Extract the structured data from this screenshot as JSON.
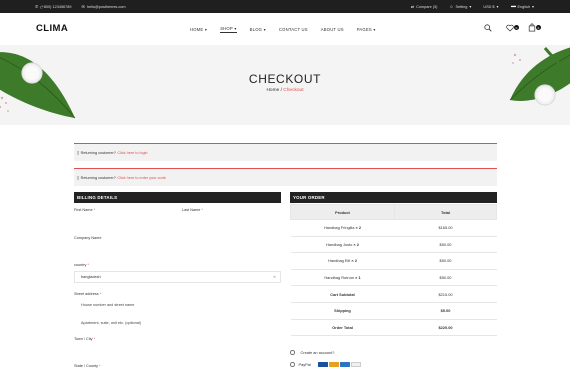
{
  "topbar": {
    "phone": "(+800) 123456789",
    "email": "hello@posthemes.com",
    "compare": "Compare (3)",
    "setting": "Setting",
    "currency": "USD $",
    "language": "English"
  },
  "header": {
    "logo": "CLIMA",
    "nav": [
      {
        "label": "HOME",
        "chevron": true
      },
      {
        "label": "SHOP",
        "chevron": true
      },
      {
        "label": "BLOG",
        "chevron": true
      },
      {
        "label": "CONTACT US",
        "chevron": false
      },
      {
        "label": "ABOUT US",
        "chevron": false
      },
      {
        "label": "PAGES",
        "chevron": true
      }
    ],
    "wishlist_count": "0",
    "cart_count": "0"
  },
  "hero": {
    "title": "CHECKOUT",
    "breadcrumb_home": "Home",
    "breadcrumb_sep": "/",
    "breadcrumb_current": "Checkout"
  },
  "notices": {
    "login_text": "Returning customer?",
    "login_link": "Click here to login",
    "coupon_text": "Returning customer?",
    "coupon_link": "Click here to enter your code"
  },
  "billing": {
    "heading": "BILLING DETAILS",
    "first_name": "First Name",
    "last_name": "Last Name",
    "company": "Company Name",
    "country_label": "country",
    "country_value": "bangladesh",
    "street_label": "Street address",
    "street_placeholder": "House number and street name",
    "apartment_placeholder": "Apartment, suite, unit etc. (optional)",
    "town_label": "Town / City",
    "state_label": "State / County",
    "required_mark": "*"
  },
  "order": {
    "heading": "YOUR ORDER",
    "col_product": "Product",
    "col_total": "Total",
    "items": [
      {
        "name": "Handbag Fringilla",
        "qty": "× 2",
        "total": "$165.00"
      },
      {
        "name": "Handbag Justo",
        "qty": "× 2",
        "total": "$50.00"
      },
      {
        "name": "Handbag Elit",
        "qty": "× 2",
        "total": "$50.00"
      },
      {
        "name": "Handbag Rutrum",
        "qty": "× 1",
        "total": "$50.00"
      }
    ],
    "cart_subtotal_label": "Cart Subtotal",
    "cart_subtotal": "$215.00",
    "shipping_label": "Shipping",
    "shipping": "$5.00",
    "order_total_label": "Order Total",
    "order_total": "$220.00",
    "create_account": "Create an account?",
    "paypal_label": "PayPal"
  },
  "colors": {
    "accent": "#e04e4e",
    "dark": "#222222"
  }
}
